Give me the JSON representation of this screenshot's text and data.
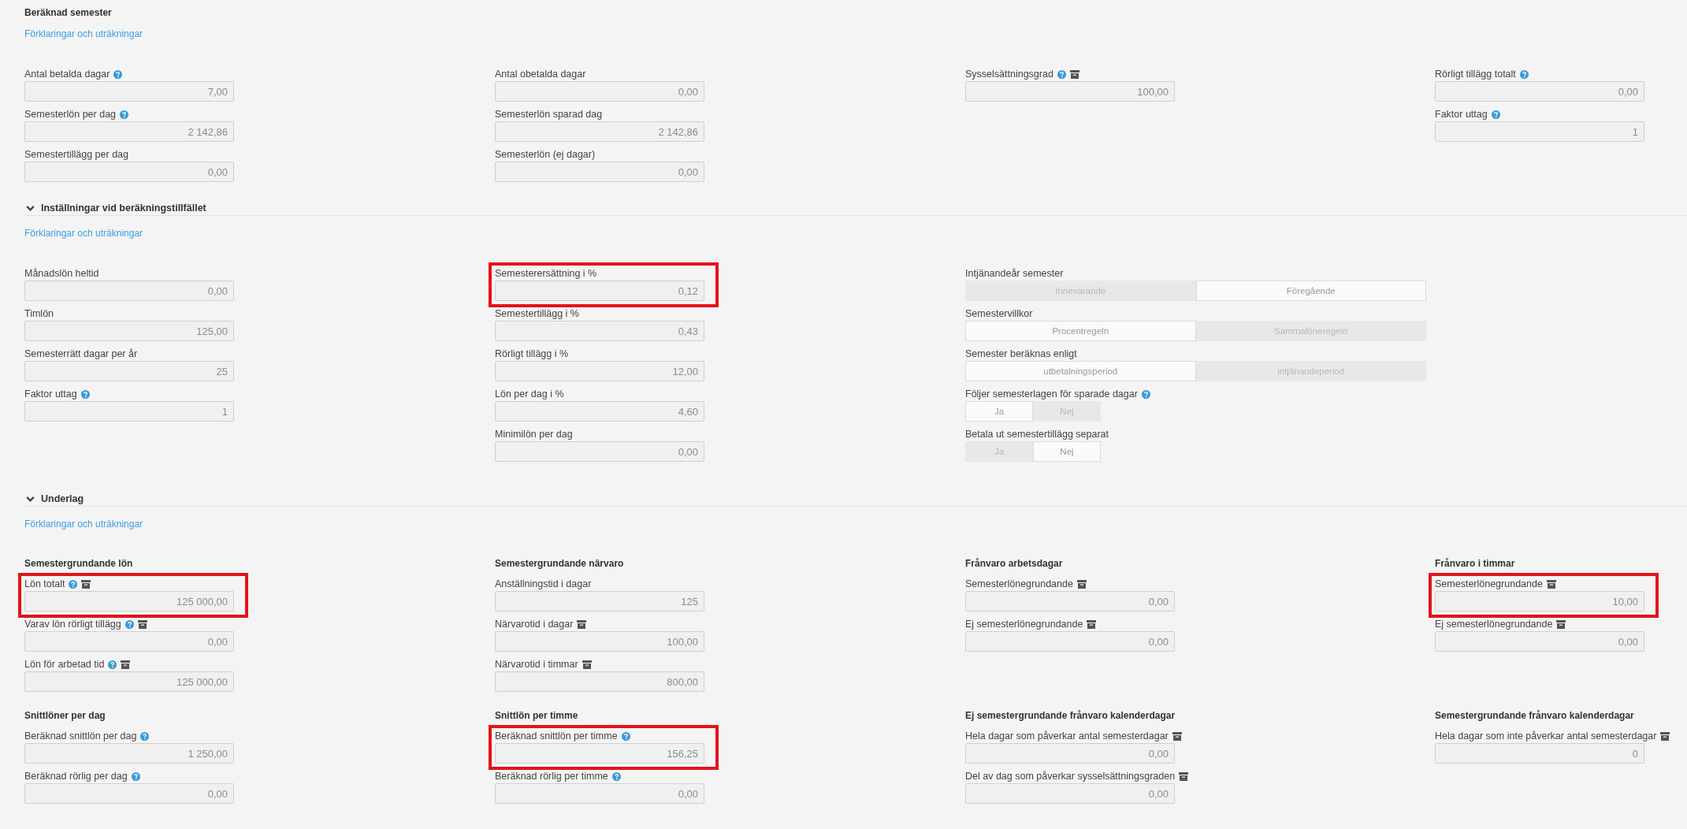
{
  "sections": [
    {
      "kind": "static",
      "title": "Beräknad semester",
      "link": "Förklaringar och uträkningar",
      "columns": [
        {
          "fields": [
            {
              "kind": "input",
              "label": "Antal betalda dagar",
              "help": true,
              "archive": false,
              "highlighted": false,
              "value": "7,00"
            },
            {
              "kind": "input",
              "label": "Semesterlön per dag",
              "help": true,
              "archive": false,
              "highlighted": false,
              "value": "2 142,86"
            },
            {
              "kind": "input",
              "label": "Semestertillägg per dag",
              "help": false,
              "archive": false,
              "highlighted": false,
              "value": "0,00"
            }
          ]
        },
        {
          "fields": [
            {
              "kind": "input",
              "label": "Antal obetalda dagar",
              "help": false,
              "archive": false,
              "highlighted": false,
              "value": "0,00"
            },
            {
              "kind": "input",
              "label": "Semesterlön sparad dag",
              "help": false,
              "archive": false,
              "highlighted": false,
              "value": "2 142,86"
            },
            {
              "kind": "input",
              "label": "Semesterlön (ej dagar)",
              "help": false,
              "archive": false,
              "highlighted": false,
              "value": "0,00"
            }
          ]
        },
        {
          "fields": [
            {
              "kind": "input",
              "label": "Sysselsättningsgrad",
              "help": true,
              "archive": true,
              "highlighted": false,
              "value": "100,00"
            }
          ]
        },
        {
          "fields": [
            {
              "kind": "input",
              "label": "Rörligt tillägg totalt",
              "help": true,
              "archive": false,
              "highlighted": false,
              "value": "0,00"
            },
            {
              "kind": "input",
              "label": "Faktor uttag",
              "help": true,
              "archive": false,
              "highlighted": false,
              "value": "1"
            }
          ]
        }
      ]
    },
    {
      "kind": "collapsible",
      "expanded": true,
      "title": "Inställningar vid beräkningstillfället",
      "link": "Förklaringar och uträkningar",
      "columns": [
        {
          "fields": [
            {
              "kind": "input",
              "label": "Månadslön heltid",
              "help": false,
              "archive": false,
              "highlighted": false,
              "value": "0,00"
            },
            {
              "kind": "input",
              "label": "Timlön",
              "help": false,
              "archive": false,
              "highlighted": false,
              "value": "125,00"
            },
            {
              "kind": "input",
              "label": "Semesterrätt dagar per år",
              "help": false,
              "archive": false,
              "highlighted": false,
              "value": "25"
            },
            {
              "kind": "input",
              "label": "Faktor uttag",
              "help": true,
              "archive": false,
              "highlighted": false,
              "value": "1"
            }
          ]
        },
        {
          "fields": [
            {
              "kind": "input",
              "label": "Semesterersättning i %",
              "help": false,
              "archive": false,
              "highlighted": true,
              "value": "0,12"
            },
            {
              "kind": "input",
              "label": "Semestertillägg i %",
              "help": false,
              "archive": false,
              "highlighted": false,
              "value": "0,43"
            },
            {
              "kind": "input",
              "label": "Rörligt tillägg i %",
              "help": false,
              "archive": false,
              "highlighted": false,
              "value": "12,00"
            },
            {
              "kind": "input",
              "label": "Lön per dag i %",
              "help": false,
              "archive": false,
              "highlighted": false,
              "value": "4,60"
            },
            {
              "kind": "input",
              "label": "Minimilön per dag",
              "help": false,
              "archive": false,
              "highlighted": false,
              "value": "0,00"
            }
          ]
        },
        {
          "fields": [
            {
              "kind": "segmented",
              "label": "Intjänandeår semester",
              "help": false,
              "archive": false,
              "highlighted": false,
              "options": [
                {
                  "label": "Innevarande",
                  "selected": false
                },
                {
                  "label": "Föregående",
                  "selected": true
                }
              ]
            },
            {
              "kind": "segmented",
              "label": "Semestervillkor",
              "help": false,
              "archive": false,
              "highlighted": false,
              "options": [
                {
                  "label": "Procentregeln",
                  "selected": true
                },
                {
                  "label": "Sammalöneregeln",
                  "selected": false
                }
              ]
            },
            {
              "kind": "segmented",
              "label": "Semester beräknas enligt",
              "help": false,
              "archive": false,
              "highlighted": false,
              "options": [
                {
                  "label": "utbetalningsperiod",
                  "selected": true
                },
                {
                  "label": "intjänandeperiod",
                  "selected": false
                }
              ]
            },
            {
              "kind": "toggle",
              "label": "Följer semesterlagen för sparade dagar",
              "help": true,
              "archive": false,
              "highlighted": false,
              "options": [
                {
                  "label": "Ja",
                  "selected": true
                },
                {
                  "label": "Nej",
                  "selected": false
                }
              ]
            },
            {
              "kind": "toggle",
              "label": "Betala ut semestertillägg separat",
              "help": false,
              "archive": false,
              "highlighted": false,
              "options": [
                {
                  "label": "Ja",
                  "selected": false
                },
                {
                  "label": "Nej",
                  "selected": true
                }
              ]
            }
          ]
        }
      ]
    },
    {
      "kind": "collapsible",
      "expanded": true,
      "title": "Underlag",
      "link": "Förklaringar och uträkningar",
      "columns": [
        {
          "groups": [
            {
              "heading": "Semestergrundande lön",
              "fields": [
                {
                  "kind": "input",
                  "label": "Lön totalt",
                  "help": true,
                  "archive": true,
                  "highlighted": true,
                  "value": "125 000,00"
                },
                {
                  "kind": "input",
                  "label": "Varav lön rörligt tillägg",
                  "help": true,
                  "archive": true,
                  "highlighted": false,
                  "value": "0,00"
                },
                {
                  "kind": "input",
                  "label": "Lön för arbetad tid",
                  "help": true,
                  "archive": true,
                  "highlighted": false,
                  "value": "125 000,00"
                }
              ]
            },
            {
              "heading": "Snittlöner per dag",
              "fields": [
                {
                  "kind": "input",
                  "label": "Beräknad snittlön per dag",
                  "help": true,
                  "archive": false,
                  "highlighted": false,
                  "value": "1 250,00"
                },
                {
                  "kind": "input",
                  "label": "Beräknad rörlig per dag",
                  "help": true,
                  "archive": false,
                  "highlighted": false,
                  "value": "0,00"
                }
              ]
            }
          ]
        },
        {
          "groups": [
            {
              "heading": "Semestergrundande närvaro",
              "fields": [
                {
                  "kind": "input",
                  "label": "Anställningstid i dagar",
                  "help": false,
                  "archive": false,
                  "highlighted": false,
                  "value": "125"
                },
                {
                  "kind": "input",
                  "label": "Närvarotid i dagar",
                  "help": false,
                  "archive": true,
                  "highlighted": false,
                  "value": "100,00"
                },
                {
                  "kind": "input",
                  "label": "Närvarotid i timmar",
                  "help": false,
                  "archive": true,
                  "highlighted": false,
                  "value": "800,00"
                }
              ]
            },
            {
              "heading": "Snittlön per timme",
              "fields": [
                {
                  "kind": "input",
                  "label": "Beräknad snittlön per timme",
                  "help": true,
                  "archive": false,
                  "highlighted": true,
                  "value": "156,25"
                },
                {
                  "kind": "input",
                  "label": "Beräknad rörlig per timme",
                  "help": true,
                  "archive": false,
                  "highlighted": false,
                  "value": "0,00"
                }
              ]
            }
          ]
        },
        {
          "groups": [
            {
              "heading": "Frånvaro arbetsdagar",
              "fields": [
                {
                  "kind": "input",
                  "label": "Semesterlönegrundande",
                  "help": false,
                  "archive": true,
                  "highlighted": false,
                  "value": "0,00"
                },
                {
                  "kind": "input",
                  "label": "Ej semesterlönegrundande",
                  "help": false,
                  "archive": true,
                  "highlighted": false,
                  "value": "0,00"
                }
              ]
            },
            {
              "heading": "Ej semestergrundande frånvaro kalenderdagar",
              "fields": [
                {
                  "kind": "input",
                  "label": "Hela dagar som påverkar antal semesterdagar",
                  "help": false,
                  "archive": true,
                  "highlighted": false,
                  "value": "0,00"
                },
                {
                  "kind": "input",
                  "label": "Del av dag som påverkar sysselsättningsgraden",
                  "help": false,
                  "archive": true,
                  "highlighted": false,
                  "value": "0,00"
                }
              ]
            }
          ]
        },
        {
          "groups": [
            {
              "heading": "Frånvaro i timmar",
              "fields": [
                {
                  "kind": "input",
                  "label": "Semesterlönegrundande",
                  "help": false,
                  "archive": true,
                  "highlighted": true,
                  "value": "10,00"
                },
                {
                  "kind": "input",
                  "label": "Ej semesterlönegrundande",
                  "help": false,
                  "archive": true,
                  "highlighted": false,
                  "value": "0,00"
                }
              ]
            },
            {
              "heading": "Semestergrundande frånvaro kalenderdagar",
              "fields": [
                {
                  "kind": "input",
                  "label": "Hela dagar som inte påverkar antal semesterdagar",
                  "help": false,
                  "archive": true,
                  "highlighted": false,
                  "value": "0"
                }
              ]
            }
          ]
        }
      ]
    }
  ]
}
